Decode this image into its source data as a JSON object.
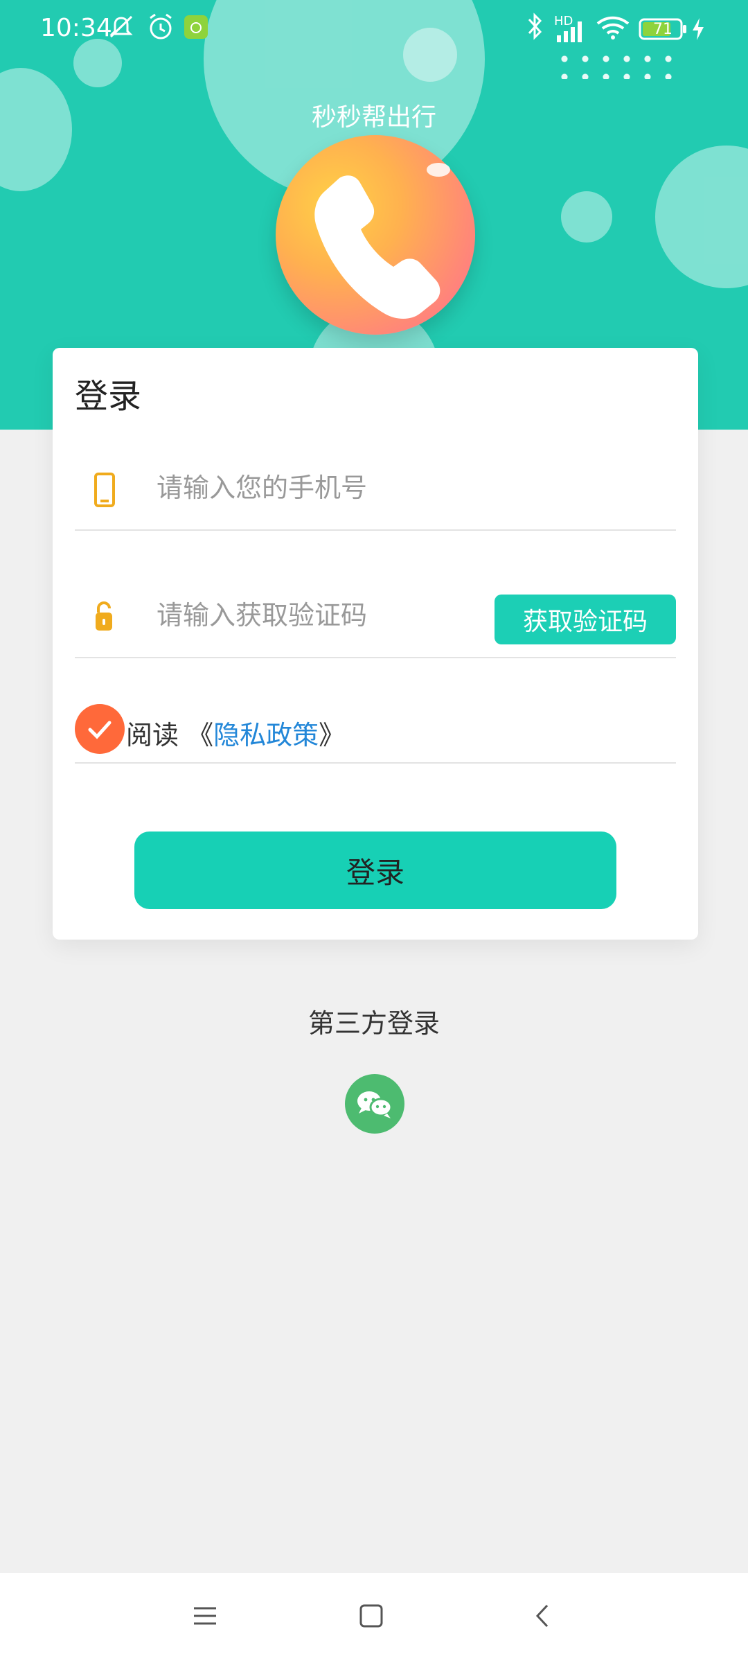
{
  "status_bar": {
    "time": "10:34",
    "battery": "71",
    "network_badge": "HD",
    "icons": [
      "mute-icon",
      "alarm-icon",
      "app-notification-icon",
      "bluetooth-icon",
      "signal-icon",
      "wifi-icon",
      "battery-icon",
      "charging-icon"
    ]
  },
  "header": {
    "app_title": "秒秒帮出行",
    "logo_icon": "phone-icon",
    "accent_color": "#22cbb1"
  },
  "login_card": {
    "title": "登录",
    "phone_placeholder": "请输入您的手机号",
    "phone_icon": "mobile-phone-icon",
    "code_placeholder": "请输入获取验证码",
    "code_icon": "lock-icon",
    "get_code_label": "获取验证码",
    "agreement_prefix": "阅读",
    "agreement_open": " 《",
    "privacy_policy_label": "隐私政策",
    "agreement_close": "》",
    "agreement_checked": true,
    "login_label": "登录"
  },
  "third_party": {
    "label": "第三方登录",
    "wechat_icon": "wechat-icon"
  },
  "nav_bar": {
    "icons": [
      "menu-icon",
      "home-icon",
      "back-icon"
    ]
  }
}
